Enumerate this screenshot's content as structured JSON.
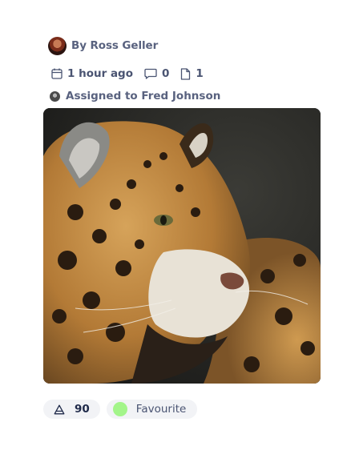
{
  "post": {
    "author": "By Ross Geller",
    "time": "1 hour ago",
    "comments": "0",
    "pages": "1",
    "assigned": "Assigned to Fred Johnson",
    "image_subject": "jaguar"
  },
  "footer": {
    "likes": "90",
    "tag_label": "Favourite",
    "tag_color": "#a3f58a"
  },
  "icons": {
    "calendar": "calendar-icon",
    "comment": "comment-icon",
    "page": "page-icon",
    "like": "triangle-icon"
  },
  "colors": {
    "text": "#4a5472",
    "chip_bg": "#f2f3f6"
  }
}
